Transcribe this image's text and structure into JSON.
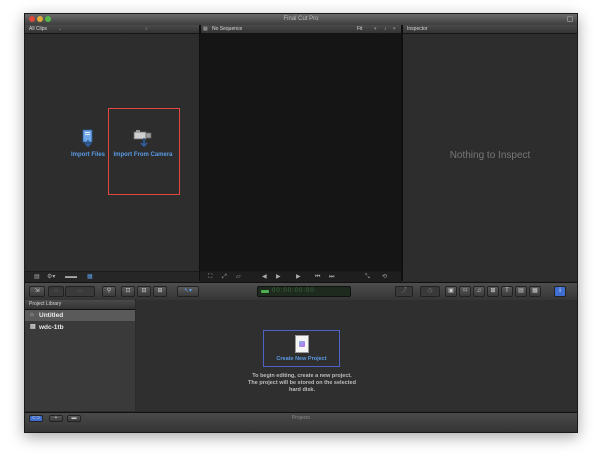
{
  "window": {
    "title": "Final Cut Pro"
  },
  "browser": {
    "header_title": "All Clips",
    "import_files_label": "Import Files",
    "import_camera_label": "Import From Camera"
  },
  "viewer": {
    "header_title": "No Sequence",
    "zoom_value": "Fit"
  },
  "inspector": {
    "header_title": "Inspector",
    "empty_message": "Nothing to Inspect"
  },
  "toolbar": {
    "timecode_digits": "00:00:00:00"
  },
  "project_library": {
    "header_title": "Project Library",
    "items": [
      {
        "label": "Untitled",
        "selected": true
      },
      {
        "label": "wdc-1tb",
        "selected": false
      }
    ],
    "create_new_label": "Create New Project",
    "help_line1": "To begin editing, create a new project.",
    "help_line2": "The project will be stored on the selected",
    "help_line3": "hard disk."
  },
  "statusbar": {
    "label": "Projects"
  },
  "colors": {
    "accent_blue": "#5b9be4",
    "highlight_red": "#e04a3e",
    "timecode_green": "#4caf50"
  }
}
